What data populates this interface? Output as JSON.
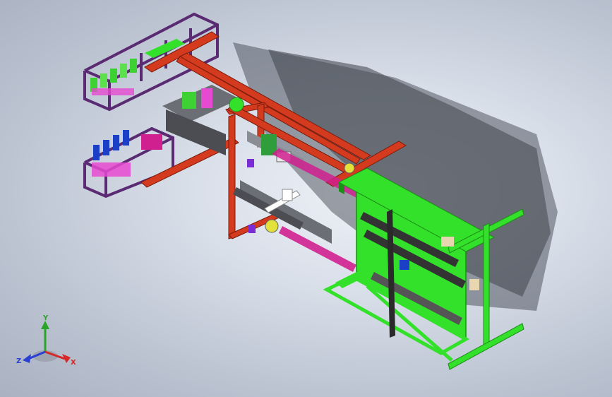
{
  "view": {
    "background_top": "#eef2f8",
    "background_bottom": "#aab2c2"
  },
  "colors": {
    "purple_frame": "#5a2a72",
    "red_beam": "#d43a1e",
    "green_frame": "#33e02a",
    "green_dark": "#1d8e18",
    "magenta_panel": "#d0208f",
    "shadow": "#3a3f4a",
    "conveyor_grey": "#6b6e74",
    "bright_green_block": "#3ed134",
    "blue_motor": "#1c3fc8"
  },
  "triad": {
    "y_label": "Y",
    "z_label": "Z",
    "x_label": "X",
    "y_color": "#2aa52a",
    "z_color": "#2a3fd4",
    "x_color": "#d42a2a"
  }
}
